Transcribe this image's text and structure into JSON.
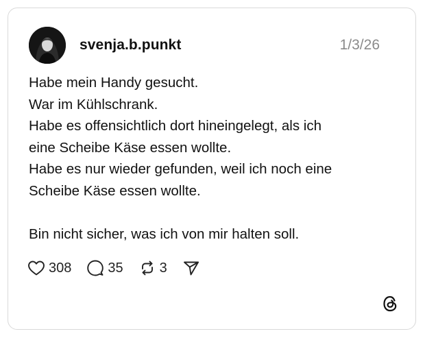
{
  "post": {
    "username": "svenja.b.punkt",
    "date": "1/3/26",
    "lines": [
      "Habe mein Handy gesucht.",
      "War im Kühlschrank.",
      "Habe es offensichtlich dort hineingelegt, als ich",
      "eine Scheibe Käse essen wollte.",
      "Habe es nur wieder gefunden, weil ich noch eine",
      "Scheibe Käse essen wollte.",
      "",
      "Bin nicht sicher, was ich von mir halten soll."
    ]
  },
  "actions": {
    "likes": "308",
    "replies": "35",
    "reposts": "3"
  },
  "icons": {
    "like": "heart-icon",
    "reply": "speech-bubble-icon",
    "repost": "repost-icon",
    "share": "paper-plane-icon",
    "brand": "threads-logo-icon"
  },
  "colors": {
    "text": "#111111",
    "muted": "#8a8a8a",
    "border": "#d9d9d9"
  }
}
